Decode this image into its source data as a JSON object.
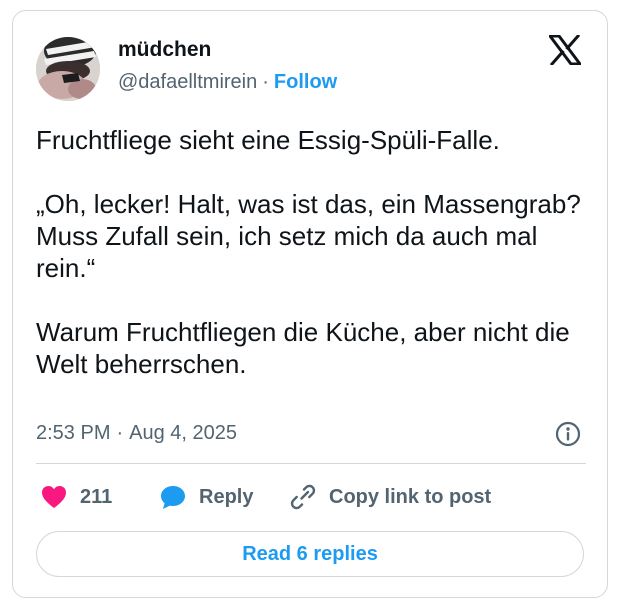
{
  "author": {
    "display_name": "müdchen",
    "handle": "@dafaelltmirein",
    "separator": "·",
    "follow_label": "Follow",
    "avatar_icon": "avatar-photo"
  },
  "platform": {
    "logo_icon": "x-logo-icon"
  },
  "tweet": {
    "paragraphs": [
      "Fruchtfliege sieht eine Essig-Spüli-Falle.",
      "„Oh, lecker! Halt, was ist das, ein Massengrab? Muss Zufall sein, ich setz mich da auch mal rein.“",
      "Warum Fruchtfliegen die Küche, aber nicht die Welt beherrschen."
    ],
    "time": "2:53 PM",
    "date_separator": "·",
    "date": "Aug 4, 2025",
    "info_icon": "info-icon"
  },
  "actions": {
    "like_count": "211",
    "like_icon": "heart-icon",
    "reply_label": "Reply",
    "reply_icon": "speech-bubble-icon",
    "copy_label": "Copy link to post",
    "copy_icon": "link-icon"
  },
  "replies_button": {
    "label": "Read 6 replies"
  },
  "colors": {
    "accent": "#1d9bf0",
    "like": "#f91880",
    "text": "#0f1419",
    "secondary": "#536471",
    "border": "#cfd9de"
  }
}
